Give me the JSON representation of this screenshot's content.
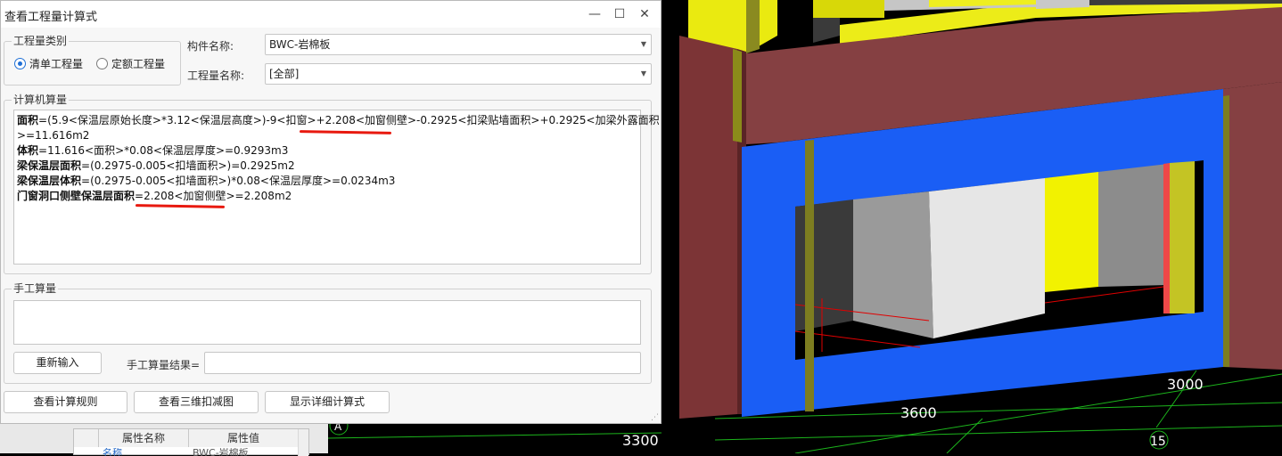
{
  "dialog": {
    "title": "查看工程量计算式",
    "controls": {
      "minimize": "—",
      "maximize": "☐",
      "close": "✕"
    }
  },
  "quantity_type": {
    "legend": "工程量类别",
    "options": [
      {
        "label": "清单工程量",
        "selected": true
      },
      {
        "label": "定额工程量",
        "selected": false
      }
    ]
  },
  "component": {
    "label": "构件名称:",
    "value": "BWC-岩棉板"
  },
  "quantity_name": {
    "label": "工程量名称:",
    "value": "[全部]"
  },
  "computer_calc": {
    "legend": "计算机算量",
    "lines": [
      {
        "bold": "面积",
        "text": "=(5.9<保温层原始长度>*3.12<保温层高度>)-9<扣窗>+2.208<加窗侧壁>-0.2925<扣梁贴墙面积>+0.2925<加梁外露面积"
      },
      {
        "bold": "",
        "text": ">=11.616m2"
      },
      {
        "bold": "体积",
        "text": "=11.616<面积>*0.08<保温层厚度>=0.9293m3"
      },
      {
        "bold": "梁保温层面积",
        "text": "=(0.2975-0.005<扣墙面积>)=0.2925m2"
      },
      {
        "bold": "梁保温层体积",
        "text": "=(0.2975-0.005<扣墙面积>)*0.08<保温层厚度>=0.0234m3"
      },
      {
        "bold": "门窗洞口侧壁保温层面积",
        "text": "=2.208<加窗侧壁>=2.208m2"
      }
    ]
  },
  "manual_calc": {
    "legend": "手工算量",
    "reenter_button": "重新输入",
    "result_label": "手工算量结果=",
    "result_value": ""
  },
  "footer_buttons": {
    "rules": "查看计算规则",
    "view3d": "查看三维扣减图",
    "detail": "显示详细计算式"
  },
  "property_panel": {
    "col_name": "属性名称",
    "col_value": "属性值",
    "row1_name": "名称",
    "row1_value": "BWC-岩棉板"
  },
  "view3d": {
    "dimensions": [
      "3600",
      "3000",
      "3300"
    ],
    "axis_labels": [
      "A",
      "15"
    ],
    "colors": {
      "wall": "#854042",
      "insulation": "#1a5ef5",
      "beam": "#f2f200",
      "grid": "#1cb51c",
      "background": "#000000"
    }
  }
}
